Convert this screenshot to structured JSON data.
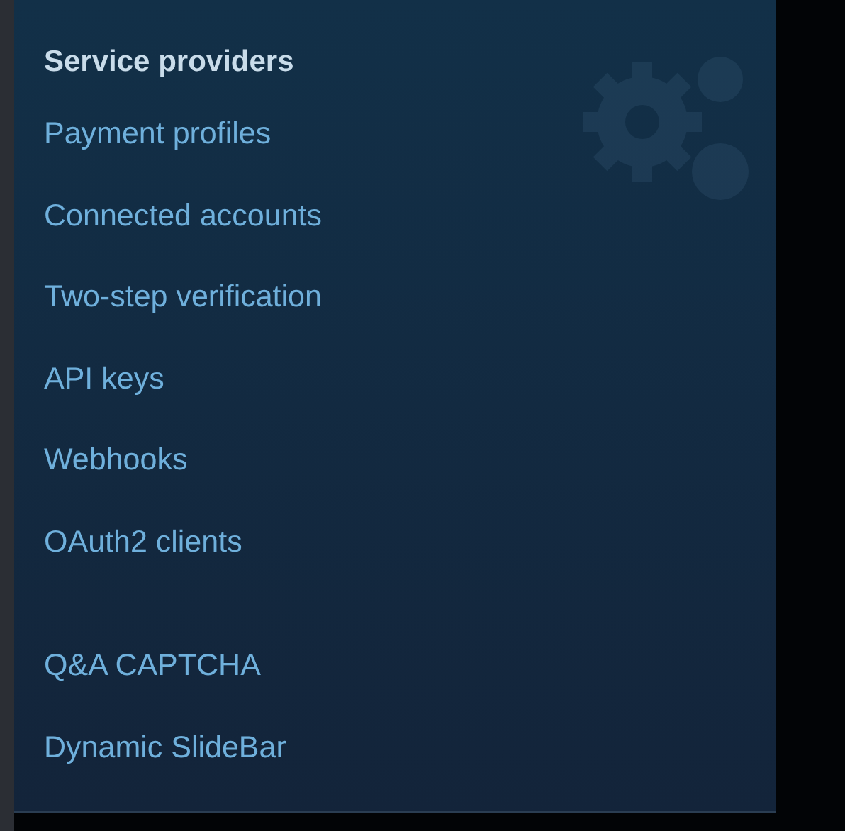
{
  "sections": [
    {
      "heading": "Service providers",
      "items": [
        {
          "label": "Payment profiles"
        },
        {
          "label": "Connected accounts"
        },
        {
          "label": "Two-step verification"
        },
        {
          "label": "API keys"
        },
        {
          "label": "Webhooks"
        },
        {
          "label": "OAuth2 clients"
        }
      ]
    },
    {
      "items": [
        {
          "label": "Q&A CAPTCHA"
        },
        {
          "label": "Dynamic SlideBar"
        }
      ]
    }
  ]
}
